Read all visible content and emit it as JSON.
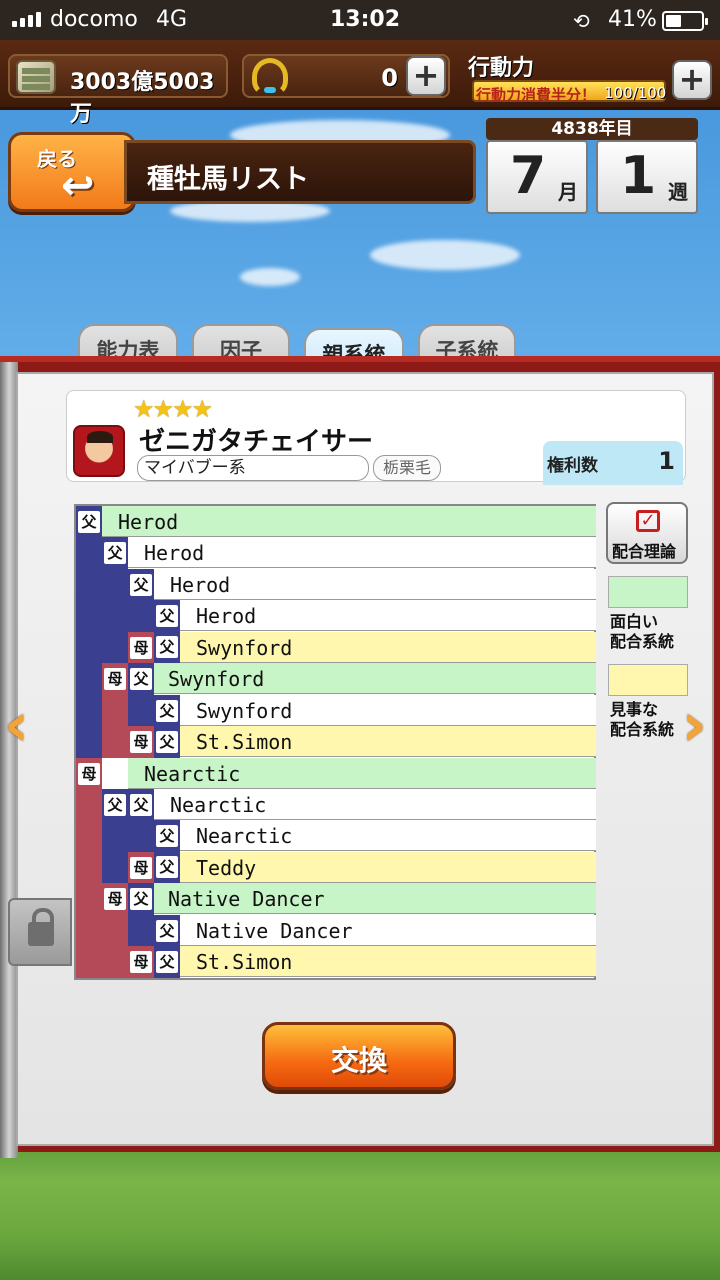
{
  "status_bar": {
    "carrier": "docomo",
    "network": "4G",
    "time": "13:02",
    "battery": "41%"
  },
  "resources": {
    "money": "3003億5003万",
    "horseshoes": "0",
    "stamina_label": "行動力",
    "stamina_note": "行動力消費半分！",
    "stamina_value": "100/100"
  },
  "header": {
    "back_label": "戻る",
    "title": "種牡馬リスト"
  },
  "calendar": {
    "year": "4838年目",
    "month": "7",
    "month_unit": "月",
    "week": "1",
    "week_unit": "週"
  },
  "tabs": [
    {
      "label": "能力表",
      "active": false
    },
    {
      "label": "因子",
      "active": false
    },
    {
      "label": "親系統",
      "active": true
    },
    {
      "label": "子系統",
      "active": false
    }
  ],
  "horse": {
    "stars": "★★★★",
    "name": "ゼニガタチェイサー",
    "lineage": "マイバブー系",
    "coat": "栃栗毛",
    "rights_label": "権利数",
    "rights_count": "1"
  },
  "glyphs": {
    "sire": "父",
    "dam": "母"
  },
  "pedigree": [
    {
      "name": "Herod",
      "color": "green"
    },
    {
      "name": "Herod",
      "color": "white"
    },
    {
      "name": "Herod",
      "color": "white"
    },
    {
      "name": "Herod",
      "color": "white"
    },
    {
      "name": "Swynford",
      "color": "yellow"
    },
    {
      "name": "Swynford",
      "color": "green"
    },
    {
      "name": "Swynford",
      "color": "white"
    },
    {
      "name": "St.Simon",
      "color": "yellow"
    },
    {
      "name": "Nearctic",
      "color": "green"
    },
    {
      "name": "Nearctic",
      "color": "white"
    },
    {
      "name": "Nearctic",
      "color": "white"
    },
    {
      "name": "Teddy",
      "color": "yellow"
    },
    {
      "name": "Native Dancer",
      "color": "green"
    },
    {
      "name": "Native Dancer",
      "color": "white"
    },
    {
      "name": "St.Simon",
      "color": "yellow"
    }
  ],
  "side": {
    "theory_label": "配合理論",
    "legend_interesting": "面白い\n配合系統",
    "legend_excellent": "見事な\n配合系統"
  },
  "exchange_label": "交換",
  "colors": {
    "interesting": "#c8f5c8",
    "excellent": "#fff7ae",
    "sire": "#3a3f8f",
    "dam": "#b44a58"
  }
}
